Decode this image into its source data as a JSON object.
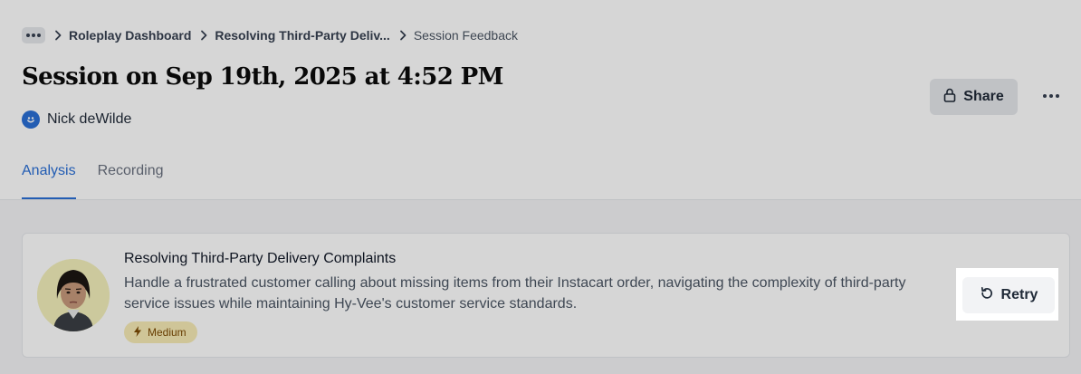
{
  "breadcrumb": {
    "more_icon": "ellipsis-icon",
    "items": [
      "Roleplay Dashboard",
      "Resolving Third-Party Deliv...",
      "Session Feedback"
    ]
  },
  "header": {
    "title": "Session on Sep 19th, 2025 at 4:52 PM",
    "user_name": "Nick deWilde",
    "share_label": "Share"
  },
  "tabs": [
    {
      "label": "Analysis",
      "active": true
    },
    {
      "label": "Recording",
      "active": false
    }
  ],
  "scenario": {
    "title": "Resolving Third-Party Delivery Complaints",
    "description": "Handle a frustrated customer calling about missing items from their Instacart order, navigating the complexity of third-party service issues while maintaining Hy-Vee's customer service standards.",
    "difficulty": "Medium",
    "retry_label": "Retry"
  },
  "colors": {
    "accent": "#2a6fd6",
    "badge_bg": "#f7ebb6",
    "badge_text": "#7c4a03"
  }
}
